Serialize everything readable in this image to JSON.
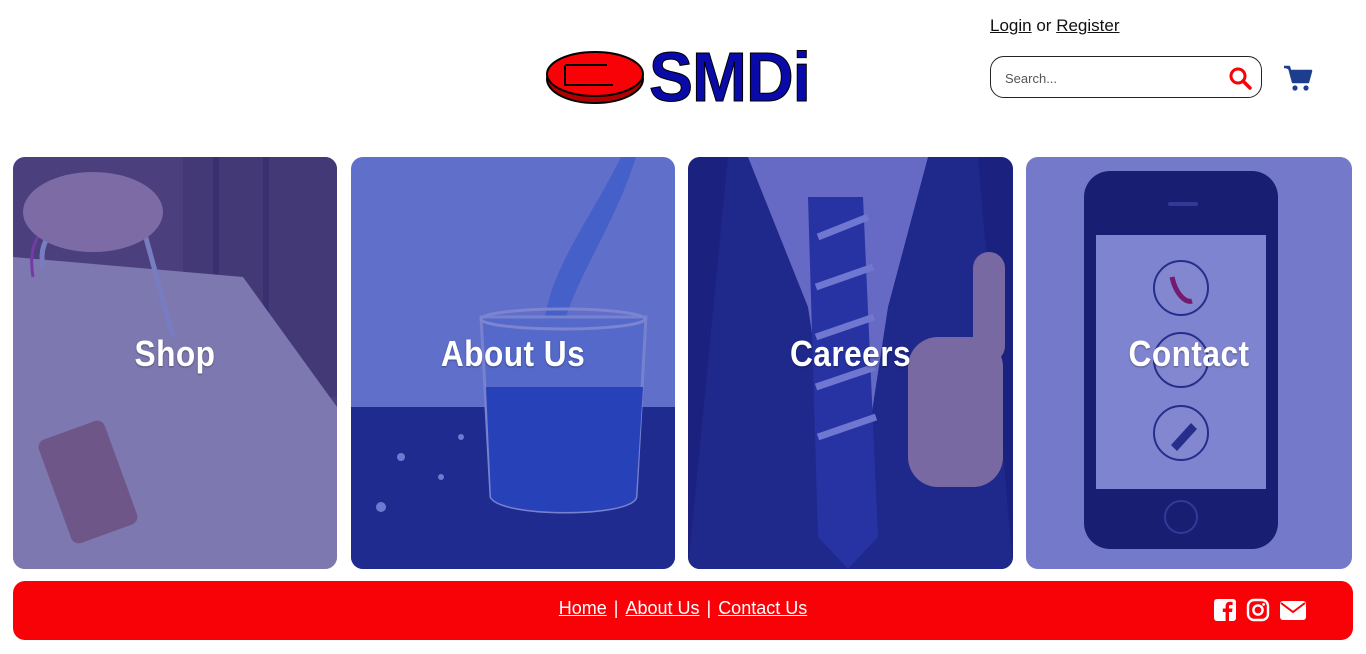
{
  "header": {
    "logo_text": "SMDi",
    "auth": {
      "login": "Login",
      "or": "or",
      "register": "Register"
    },
    "search": {
      "placeholder": "Search..."
    },
    "icons": {
      "search": "search-icon",
      "cart": "cart-icon"
    }
  },
  "tiles": [
    {
      "label": "Shop"
    },
    {
      "label": "About Us"
    },
    {
      "label": "Careers"
    },
    {
      "label": "Contact"
    }
  ],
  "footer": {
    "links": [
      "Home",
      "About Us",
      "Contact Us"
    ],
    "separator": "|",
    "social": [
      "facebook-icon",
      "instagram-icon",
      "email-icon"
    ]
  },
  "colors": {
    "brand_red": "#f80208",
    "brand_blue": "#0a0aa8",
    "tile_overlay": "#242caa",
    "cart_blue": "#1d3d8f"
  }
}
